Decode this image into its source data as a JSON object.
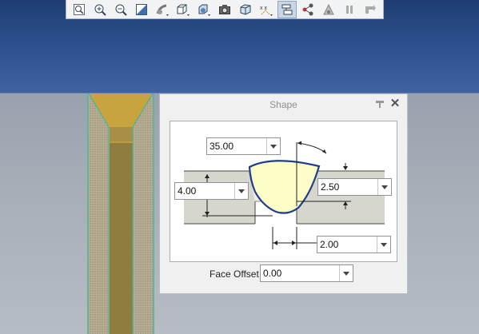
{
  "toolbar": {
    "icons": [
      "zoom-fit-icon",
      "zoom-in-icon",
      "zoom-out-icon",
      "display-style-icon",
      "orient-icon",
      "saved-views-icon",
      "appearance-icon",
      "camera-icon",
      "perspective-icon",
      "datum-display-icon",
      "annotation-display-icon",
      "connect-icon",
      "spin-center-icon",
      "pause-icon",
      "exit-icon"
    ],
    "active": "annotation-display-icon"
  },
  "dialog": {
    "title": "Shape",
    "angle_value": "35.00",
    "depth_value": "4.00",
    "root_value": "2.50",
    "gap_value": "2.00",
    "face_offset_label": "Face Offset",
    "face_offset_value": "0.00"
  }
}
